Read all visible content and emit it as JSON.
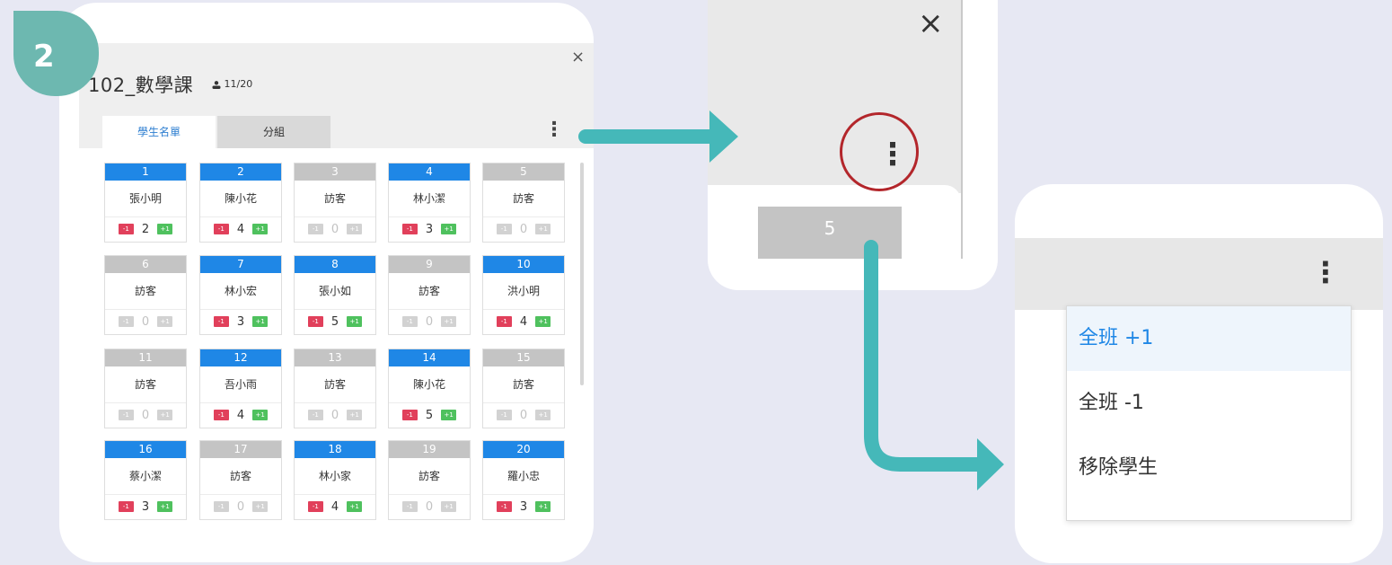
{
  "step": "2",
  "panel1": {
    "class_title": "102_數學課",
    "count_icon": "person-icon",
    "count": "11/20",
    "close": "×",
    "tabs": [
      "學生名單",
      "分組"
    ],
    "more": "⋮",
    "cards": [
      {
        "num": "1",
        "name": "張小明",
        "score": "2",
        "active": true
      },
      {
        "num": "2",
        "name": "陳小花",
        "score": "4",
        "active": true
      },
      {
        "num": "3",
        "name": "訪客",
        "score": "0",
        "active": false
      },
      {
        "num": "4",
        "name": "林小潔",
        "score": "3",
        "active": true
      },
      {
        "num": "5",
        "name": "訪客",
        "score": "0",
        "active": false
      },
      {
        "num": "6",
        "name": "訪客",
        "score": "0",
        "active": false
      },
      {
        "num": "7",
        "name": "林小宏",
        "score": "3",
        "active": true
      },
      {
        "num": "8",
        "name": "張小如",
        "score": "5",
        "active": true
      },
      {
        "num": "9",
        "name": "訪客",
        "score": "0",
        "active": false
      },
      {
        "num": "10",
        "name": "洪小明",
        "score": "4",
        "active": true
      },
      {
        "num": "11",
        "name": "訪客",
        "score": "0",
        "active": false
      },
      {
        "num": "12",
        "name": "吾小雨",
        "score": "4",
        "active": true
      },
      {
        "num": "13",
        "name": "訪客",
        "score": "0",
        "active": false
      },
      {
        "num": "14",
        "name": "陳小花",
        "score": "5",
        "active": true
      },
      {
        "num": "15",
        "name": "訪客",
        "score": "0",
        "active": false
      },
      {
        "num": "16",
        "name": "蔡小潔",
        "score": "3",
        "active": true
      },
      {
        "num": "17",
        "name": "訪客",
        "score": "0",
        "active": false
      },
      {
        "num": "18",
        "name": "林小家",
        "score": "4",
        "active": true
      },
      {
        "num": "19",
        "name": "訪客",
        "score": "0",
        "active": false
      },
      {
        "num": "20",
        "name": "羅小忠",
        "score": "3",
        "active": true
      }
    ],
    "minus_label": "-1",
    "plus_label": "+1"
  },
  "panel2": {
    "close": "×",
    "more": "⋮",
    "card_num": "5"
  },
  "panel3": {
    "more": "⋮",
    "menu": [
      "全班 +1",
      "全班 -1",
      "移除學生"
    ]
  },
  "colors": {
    "accent_blue": "#1f87e6",
    "inactive_grey": "#c4c4c4",
    "minus_red": "#e1405b",
    "plus_green": "#4fc15e",
    "arrow_teal": "#45b8b9",
    "badge_teal": "#6db8b0",
    "highlight_circle": "#b3262b"
  }
}
